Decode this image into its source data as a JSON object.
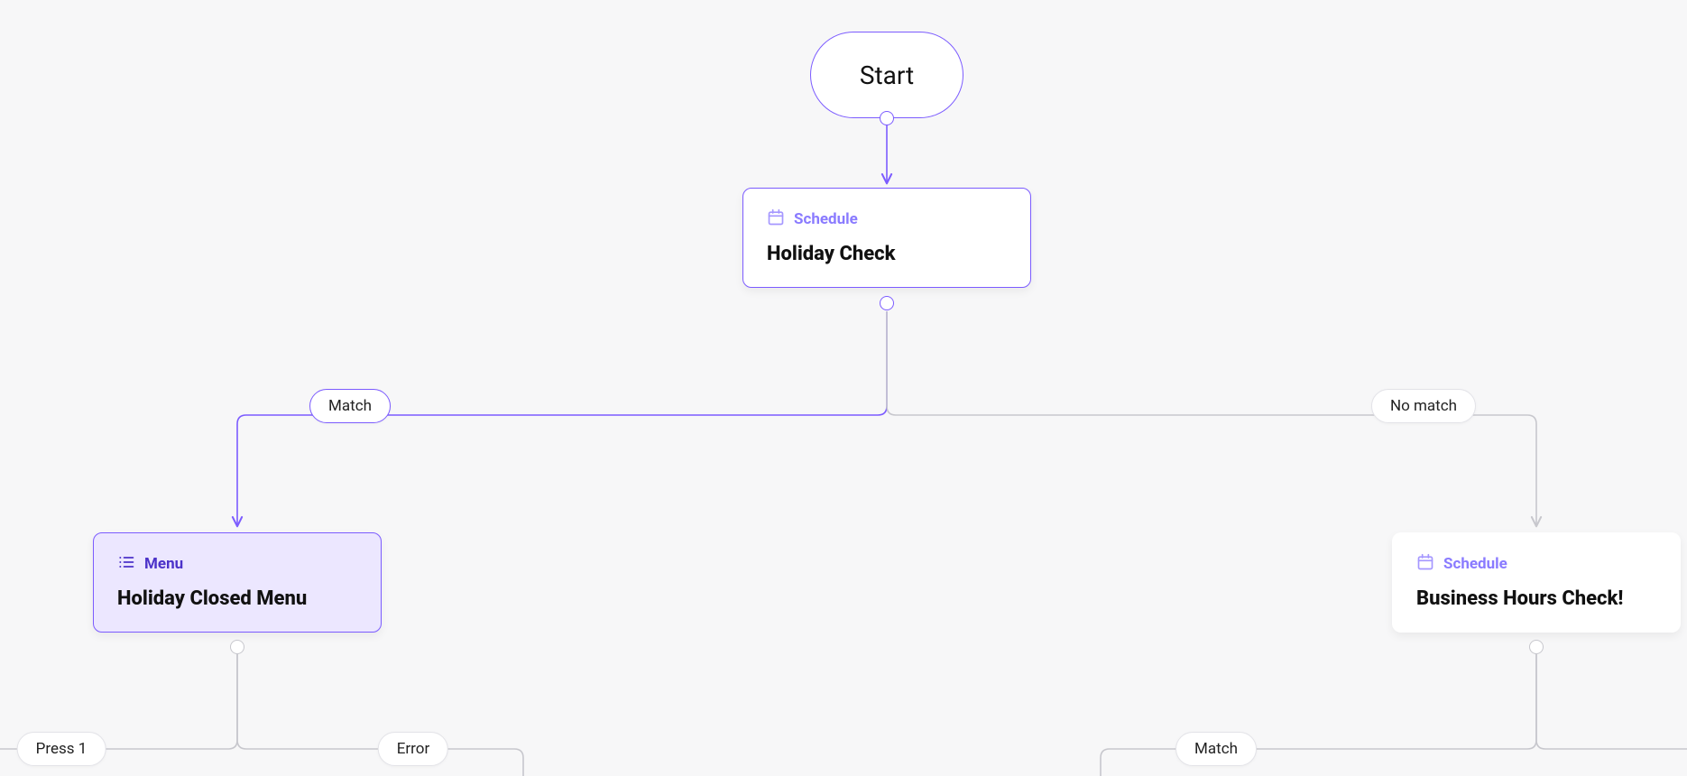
{
  "nodes": {
    "start": {
      "label": "Start"
    },
    "holiday_check": {
      "type_label": "Schedule",
      "title": "Holiday Check"
    },
    "holiday_closed_menu": {
      "type_label": "Menu",
      "title": "Holiday Closed Menu"
    },
    "business_hours_check": {
      "type_label": "Schedule",
      "title": "Business Hours Check!"
    }
  },
  "edge_labels": {
    "match1": "Match",
    "no_match": "No match",
    "press1": "Press 1",
    "error": "Error",
    "match2": "Match"
  },
  "colors": {
    "purple": "#7c5cff",
    "purple_dark": "#4c33c9",
    "purple_light_bg": "#ece7ff",
    "gray_border": "#c7c7cd",
    "canvas_bg": "#f7f7f8"
  }
}
